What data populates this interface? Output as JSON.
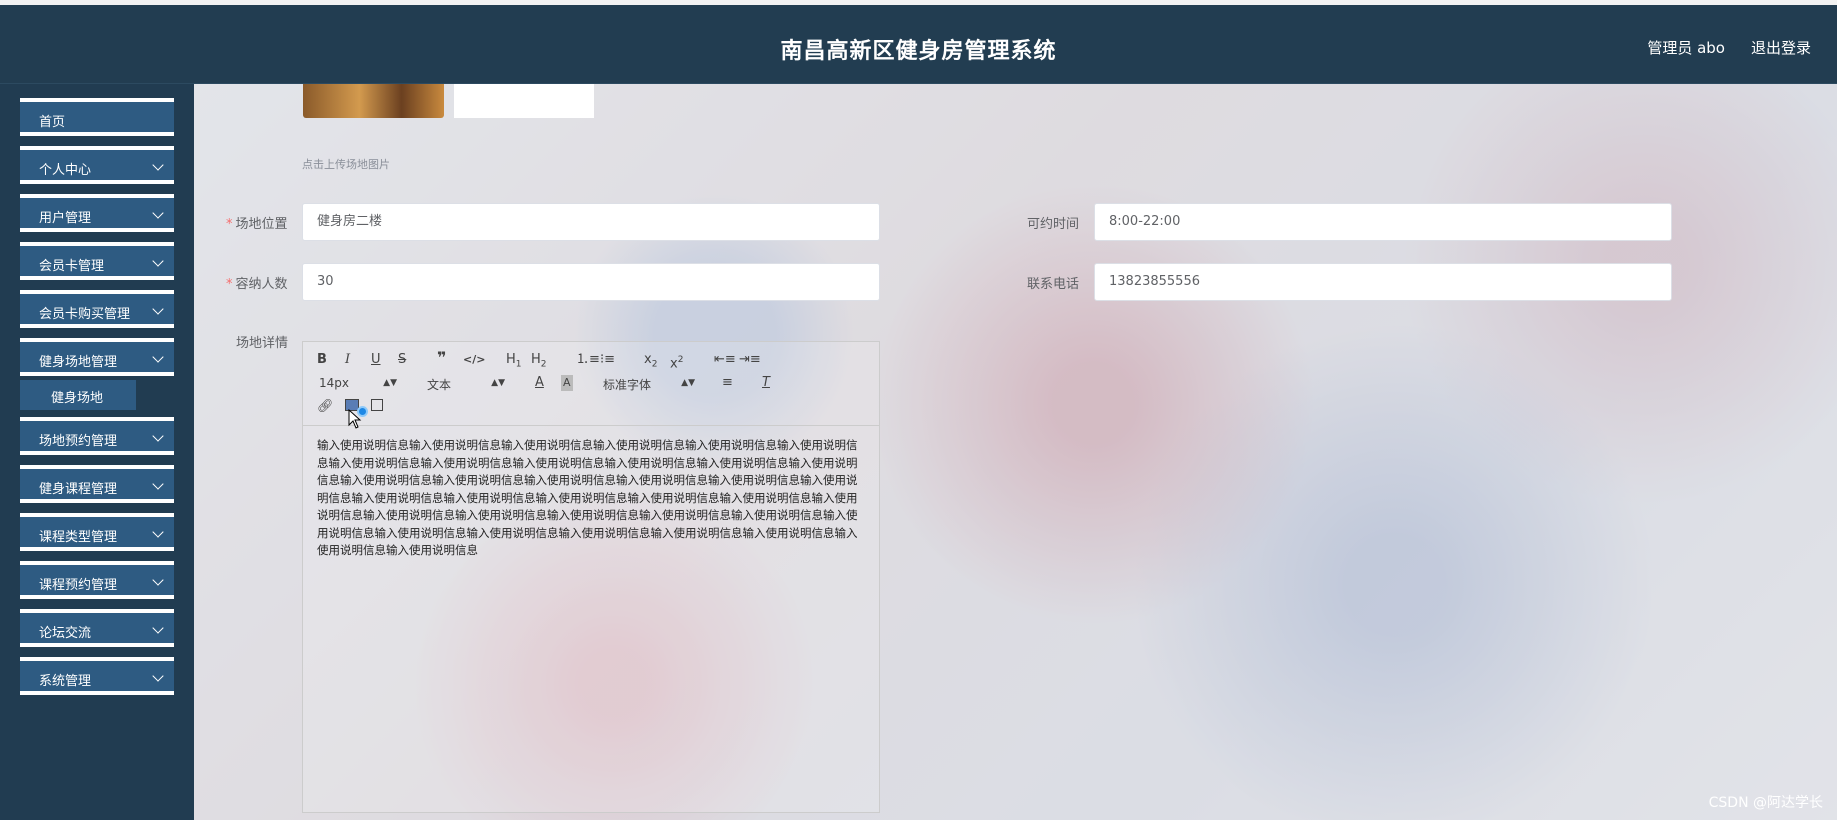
{
  "header": {
    "title": "南昌高新区健身房管理系统",
    "user": "管理员 abo",
    "logout": "退出登录"
  },
  "sidebar": {
    "items": [
      {
        "label": "首页",
        "has_children": false
      },
      {
        "label": "个人中心",
        "has_children": true
      },
      {
        "label": "用户管理",
        "has_children": true
      },
      {
        "label": "会员卡管理",
        "has_children": true
      },
      {
        "label": "会员卡购买管理",
        "has_children": true
      },
      {
        "label": "健身场地管理",
        "has_children": true,
        "expanded": true
      },
      {
        "label": "场地预约管理",
        "has_children": true
      },
      {
        "label": "健身课程管理",
        "has_children": true
      },
      {
        "label": "课程类型管理",
        "has_children": true
      },
      {
        "label": "课程预约管理",
        "has_children": true
      },
      {
        "label": "论坛交流",
        "has_children": true
      },
      {
        "label": "系统管理",
        "has_children": true
      }
    ],
    "submenu_active": "健身场地"
  },
  "form": {
    "upload_hint": "点击上传场地图片",
    "location": {
      "label": "场地位置",
      "value": "健身房二楼",
      "required": true
    },
    "available_time": {
      "label": "可约时间",
      "value": "8:00-22:00",
      "required": false
    },
    "capacity": {
      "label": "容纳人数",
      "value": "30",
      "required": true
    },
    "phone": {
      "label": "联系电话",
      "value": "13823855556",
      "required": false
    },
    "details_label": "场地详情"
  },
  "editor": {
    "font_size": "14px",
    "block_type": "文本",
    "font_family": "标准字体",
    "toolbar_icons": [
      "bold-icon",
      "italic-icon",
      "underline-icon",
      "strikethrough-icon",
      "blockquote-icon",
      "code-icon",
      "h1-icon",
      "h2-icon",
      "ordered-list-icon",
      "bullet-list-icon",
      "subscript-icon",
      "superscript-icon",
      "outdent-icon",
      "indent-icon",
      "font-color-icon",
      "background-color-icon",
      "align-icon",
      "clear-format-icon",
      "link-icon",
      "image-icon",
      "video-icon"
    ],
    "content": "输入使用说明信息输入使用说明信息输入使用说明信息输入使用说明信息输入使用说明信息输入使用说明信息输入使用说明信息输入使用说明信息输入使用说明信息输入使用说明信息输入使用说明信息输入使用说明信息输入使用说明信息输入使用说明信息输入使用说明信息输入使用说明信息输入使用说明信息输入使用说明信息输入使用说明信息输入使用说明信息输入使用说明信息输入使用说明信息输入使用说明信息输入使用说明信息输入使用说明信息输入使用说明信息输入使用说明信息输入使用说明信息输入使用说明信息输入使用说明信息输入使用说明信息输入使用说明信息输入使用说明信息输入使用说明信息输入使用说明信息输入使用说明信息输入使用说明信息"
  },
  "watermark": "CSDN @阿达学长"
}
